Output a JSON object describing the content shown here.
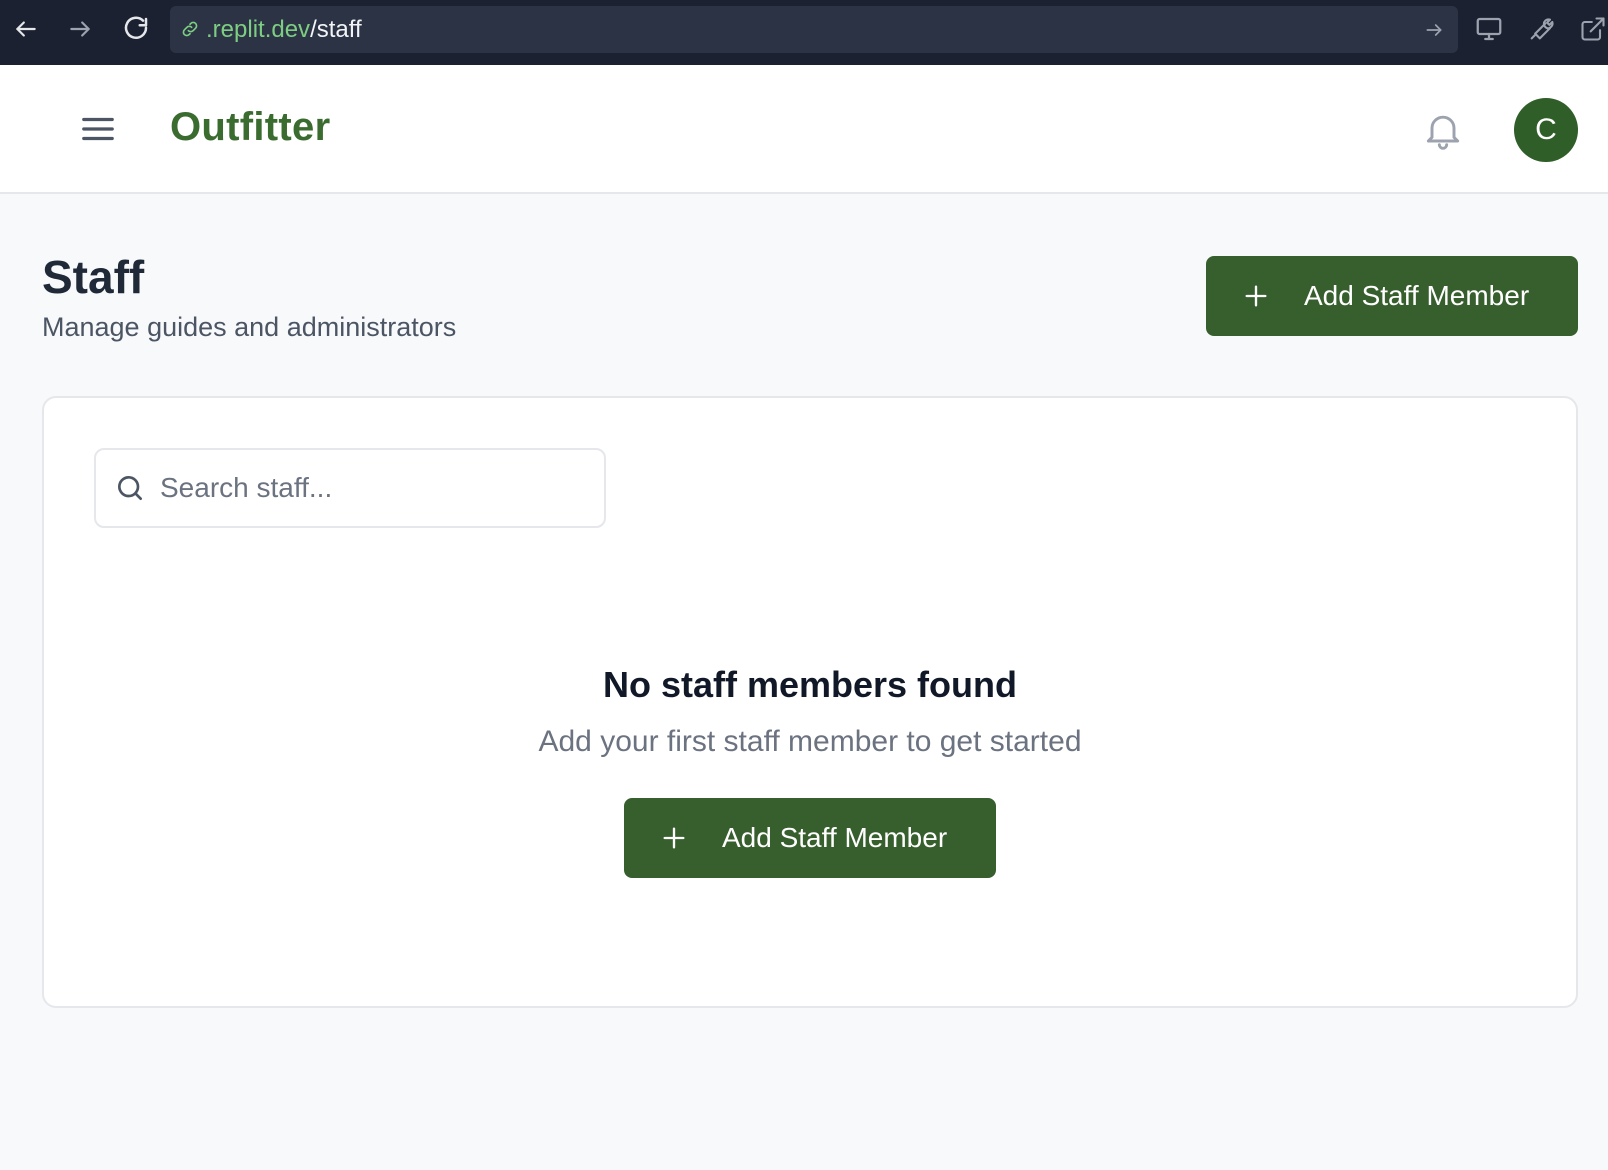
{
  "browser": {
    "url_domain": ".replit.dev",
    "url_path": "/staff"
  },
  "app": {
    "brand": "Outfitter",
    "user_initial": "C"
  },
  "page": {
    "title": "Staff",
    "subtitle": "Manage guides and administrators",
    "add_button_label": "Add Staff Member"
  },
  "search": {
    "placeholder": "Search staff...",
    "value": ""
  },
  "empty_state": {
    "title": "No staff members found",
    "description": "Add your first staff member to get started",
    "button_label": "Add Staff Member"
  },
  "colors": {
    "brand_green": "#3a6b2f",
    "button_green": "#375f2d",
    "avatar_green": "#2f5e29",
    "browser_bar": "#1b2130",
    "url_domain": "#7dce82"
  },
  "icons": {
    "back": "arrow-left-icon",
    "forward": "arrow-right-icon",
    "reload": "reload-icon",
    "link": "link-icon",
    "go": "arrow-right-icon",
    "monitor": "monitor-icon",
    "wrench": "wrench-icon",
    "external": "external-link-icon",
    "menu": "hamburger-menu-icon",
    "bell": "bell-icon",
    "plus": "plus-icon",
    "search": "search-icon"
  }
}
